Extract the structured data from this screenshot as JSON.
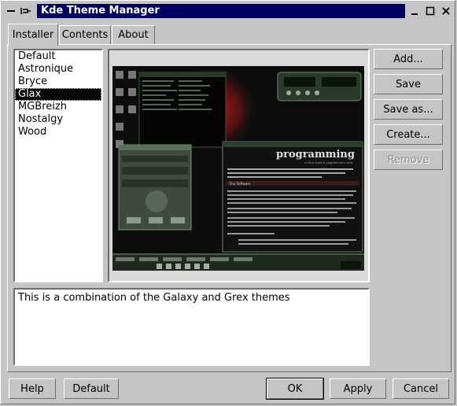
{
  "window": {
    "title": "Kde Theme Manager"
  },
  "tabs": [
    {
      "label": "Installer"
    },
    {
      "label": "Contents"
    },
    {
      "label": "About"
    }
  ],
  "themes": {
    "items": [
      "Default",
      "Astronique",
      "Bryce",
      "Glax",
      "MGBreizh",
      "Nostalgy",
      "Wood"
    ],
    "selected": "Glax"
  },
  "preview": {
    "banner": "programming",
    "subtitle": "a Linux Tools & programmer's view",
    "window_title_1": "Tiny Software"
  },
  "description": "This is a combination of the Galaxy and Grex themes",
  "side_buttons": {
    "add": "Add...",
    "save": "Save",
    "save_as": "Save as...",
    "create": "Create...",
    "remove": "Remove"
  },
  "bottom_buttons": {
    "help": "Help",
    "default": "Default",
    "ok": "OK",
    "apply": "Apply",
    "cancel": "Cancel"
  },
  "colors": {
    "title_bar": "#000060",
    "background": "#c5c5c5",
    "selection": "#000000"
  }
}
